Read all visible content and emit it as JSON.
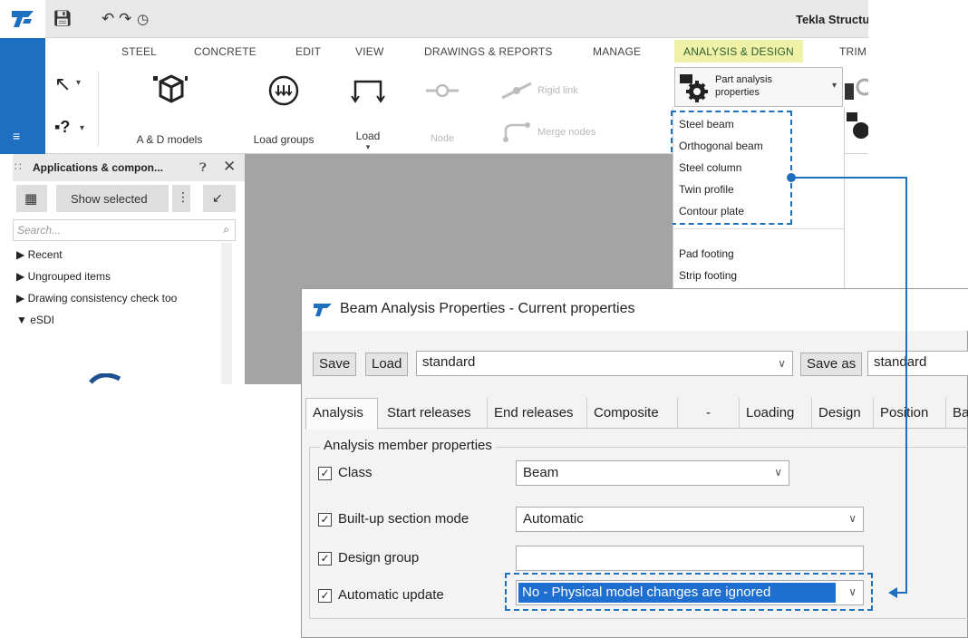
{
  "titlebar": {
    "app_title": "Tekla Structu",
    "icons": [
      "tekla-logo",
      "save-icon",
      "undo-icon",
      "redo-icon",
      "history-icon"
    ]
  },
  "ribbon": {
    "tabs": [
      "STEEL",
      "CONCRETE",
      "EDIT",
      "VIEW",
      "DRAWINGS & REPORTS",
      "MANAGE",
      "ANALYSIS & DESIGN",
      "TRIM"
    ],
    "buttons": {
      "ad_models": "A & D models",
      "load_groups": "Load groups",
      "load": "Load",
      "node": "Node",
      "rigid_link": "Rigid link",
      "merge_nodes": "Merge nodes",
      "part_analysis": "Part analysis properties"
    }
  },
  "part_menu": {
    "items_group1": [
      "Steel beam",
      "Orthogonal beam",
      "Steel column",
      "Twin profile",
      "Contour plate"
    ],
    "items_group2": [
      "Pad footing",
      "Strip footing"
    ]
  },
  "side_panel": {
    "title": "Applications & compon...",
    "show_selected": "Show selected",
    "search_placeholder": "Search...",
    "tree": [
      "Recent",
      "Ungrouped items",
      "Drawing consistency check too",
      "eSDI"
    ]
  },
  "dialog": {
    "title": "Beam Analysis Properties - Current properties",
    "save": "Save",
    "load": "Load",
    "preset": "standard",
    "save_as": "Save as",
    "save_as_value": "standard",
    "tabs": [
      "Analysis",
      "Start releases",
      "End releases",
      "Composite",
      "-",
      "Loading",
      "Design",
      "Position",
      "Ba"
    ],
    "group_title": "Analysis member properties",
    "rows": [
      {
        "label": "Class",
        "value": "Beam",
        "checked": true
      },
      {
        "label": "Built-up section mode",
        "value": "Automatic",
        "checked": true
      },
      {
        "label": "Design group",
        "value": "",
        "checked": true
      },
      {
        "label": "Automatic update",
        "value": "No - Physical model changes are ignored",
        "checked": true
      }
    ]
  },
  "colors": {
    "accent_blue": "#1e6fbf",
    "active_tab": "#eef1a6",
    "selection": "#1f6fd1"
  }
}
